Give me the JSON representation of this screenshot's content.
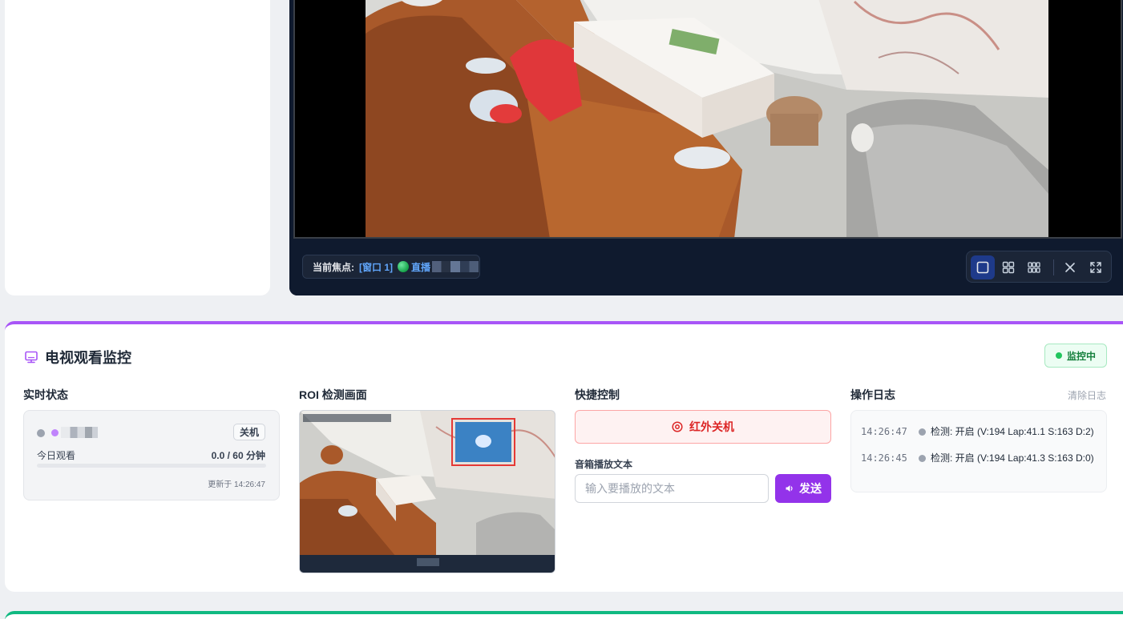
{
  "viewer": {
    "focus_label": "当前焦点:",
    "focus_window": "[窗口 1]",
    "focus_live": "直播",
    "layout_buttons": [
      "single-view",
      "grid-2x2",
      "grid-3x3"
    ],
    "action_buttons": [
      "close",
      "fullscreen"
    ]
  },
  "tv_monitor": {
    "title": "电视观看监控",
    "status": "监控中",
    "colors": {
      "accent": "#a855f7",
      "status": "#22c55e",
      "danger": "#dc2626"
    },
    "realtime": {
      "heading": "实时状态",
      "power_badge": "关机",
      "today_label": "今日观看",
      "today_value": "0.0 / 60 分钟",
      "progress_fraction": 0.0,
      "updated": "更新于 14:26:47"
    },
    "roi": {
      "heading": "ROI 检测画面"
    },
    "quick_control": {
      "heading": "快捷控制",
      "ir_off_label": "红外关机",
      "speaker_label": "音箱播放文本",
      "speaker_placeholder": "输入要播放的文本",
      "send_label": "发送"
    },
    "log": {
      "heading": "操作日志",
      "clear_label": "清除日志",
      "entries": [
        {
          "time": "14:26:47",
          "text": "检测: 开启 (V:194 Lap:41.1 S:163 D:2)"
        },
        {
          "time": "14:26:45",
          "text": "检测: 开启 (V:194 Lap:41.3 S:163 D:0)"
        }
      ]
    }
  }
}
